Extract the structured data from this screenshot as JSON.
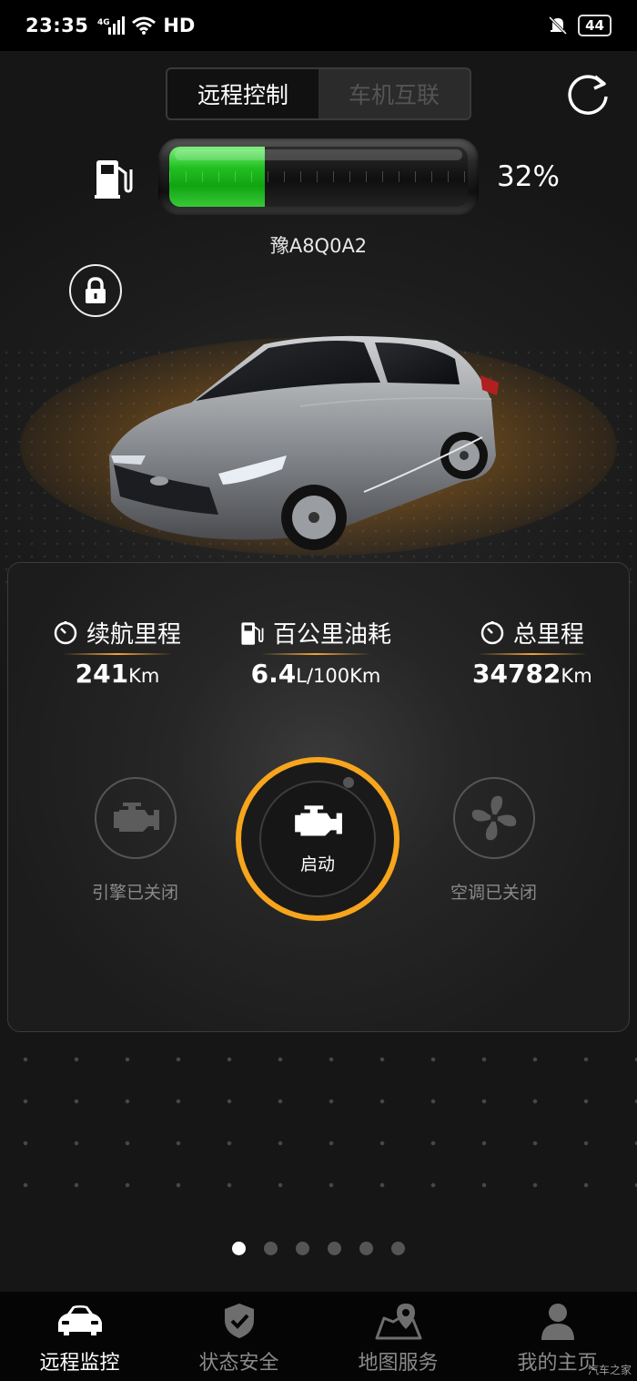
{
  "status_bar": {
    "time": "23:35",
    "network": "4G",
    "hd": "HD",
    "battery": "44"
  },
  "top_tabs": [
    {
      "label": "远程控制",
      "active": true
    },
    {
      "label": "车机互联",
      "active": false
    }
  ],
  "fuel": {
    "percent_text": "32%",
    "level": 0.32,
    "plate": "豫A8Q0A2"
  },
  "stats": [
    {
      "label": "续航里程",
      "value": "241",
      "unit": "Km",
      "icon": "timer-icon"
    },
    {
      "label": "百公里油耗",
      "value": "6.4",
      "unit": "L/100Km",
      "icon": "fuel-pump-icon"
    },
    {
      "label": "总里程",
      "value": "34782",
      "unit": "Km",
      "icon": "timer-icon"
    }
  ],
  "controls": {
    "engine_status": "引擎已关闭",
    "start_label": "启动",
    "ac_status": "空调已关闭"
  },
  "pager": {
    "count": 6,
    "active": 0
  },
  "nav": [
    {
      "label": "远程监控",
      "icon": "car-icon",
      "active": true
    },
    {
      "label": "状态安全",
      "icon": "shield-check-icon",
      "active": false
    },
    {
      "label": "地图服务",
      "icon": "map-pin-icon",
      "active": false
    },
    {
      "label": "我的主页",
      "icon": "person-icon",
      "active": false
    }
  ],
  "watermark": "汽车之家",
  "colors": {
    "accent_orange": "#f7a51c",
    "fuel_green": "#22c022",
    "background": "#151515"
  }
}
